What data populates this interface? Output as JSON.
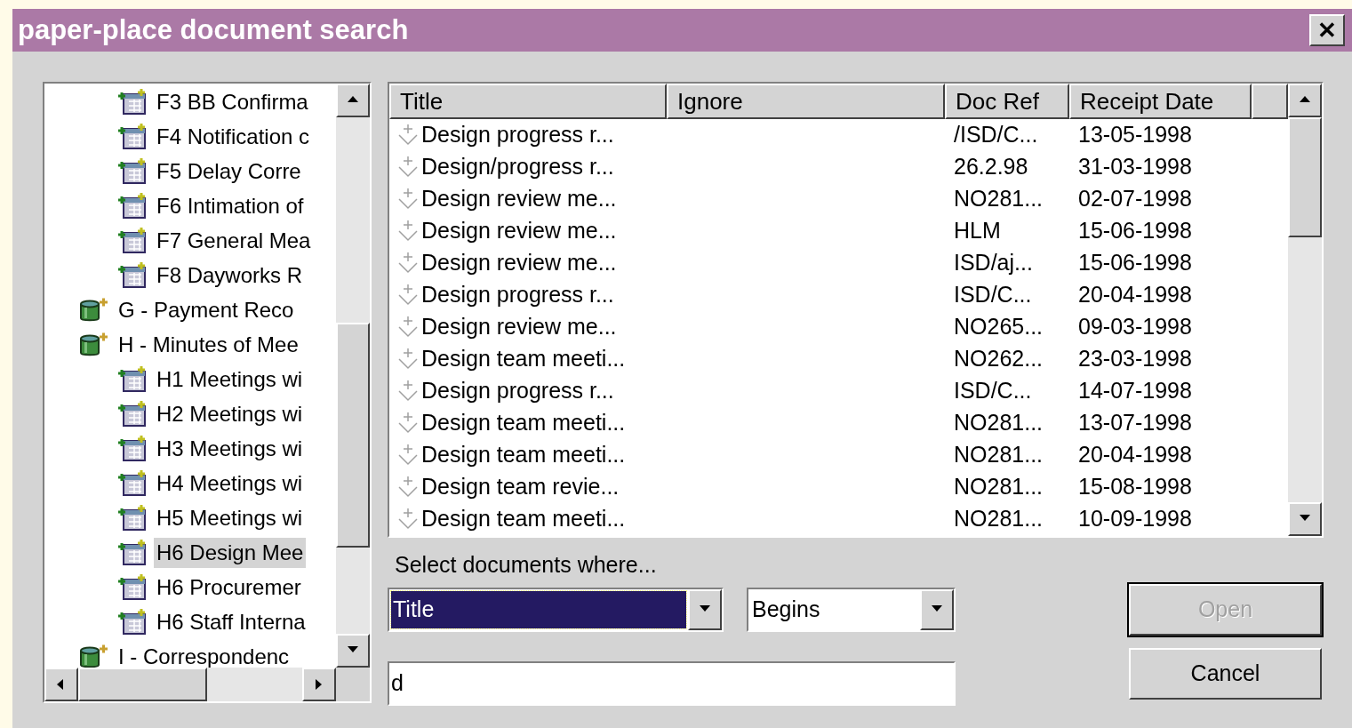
{
  "window": {
    "title": "paper-place document search",
    "close": "✕"
  },
  "tree": {
    "items": [
      {
        "children": [
          {
            "kind": "document",
            "label": "F3 BB Confirma",
            "selected": false
          },
          {
            "kind": "document",
            "label": "F4 Notification c",
            "selected": false
          },
          {
            "kind": "document",
            "label": "F5 Delay Corre",
            "selected": false
          },
          {
            "kind": "document",
            "label": "F6 Intimation of",
            "selected": false
          },
          {
            "kind": "document",
            "label": "F7 General Mea",
            "selected": false
          },
          {
            "kind": "document",
            "label": "F8 Dayworks R",
            "selected": false
          }
        ]
      },
      {
        "kind": "group",
        "label": "G - Payment Reco",
        "selected": false
      },
      {
        "kind": "group",
        "label": "H - Minutes of Mee",
        "selected": false,
        "children": [
          {
            "kind": "document",
            "label": "H1 Meetings wi",
            "selected": false
          },
          {
            "kind": "document",
            "label": "H2 Meetings wi",
            "selected": false
          },
          {
            "kind": "document",
            "label": "H3 Meetings wi",
            "selected": false
          },
          {
            "kind": "document",
            "label": "H4 Meetings wi",
            "selected": false
          },
          {
            "kind": "document",
            "label": "H5 Meetings wi",
            "selected": false
          },
          {
            "kind": "document",
            "label": "H6 Design Mee",
            "selected": true
          },
          {
            "kind": "document",
            "label": "H6 Procuremer",
            "selected": false
          },
          {
            "kind": "document",
            "label": "H6 Staff Interna",
            "selected": false
          }
        ]
      },
      {
        "kind": "group",
        "label": "I - Correspondenc",
        "selected": false
      }
    ]
  },
  "table": {
    "columns": [
      "Title",
      "Ignore",
      "Doc Ref",
      "Receipt Date"
    ],
    "rows": [
      [
        "Design progress r...",
        "",
        "/ISD/C...",
        "13-05-1998"
      ],
      [
        "Design/progress r...",
        "",
        "26.2.98",
        "31-03-1998"
      ],
      [
        "Design review me...",
        "",
        "NO281...",
        "02-07-1998"
      ],
      [
        "Design review me...",
        "",
        "HLM",
        "15-06-1998"
      ],
      [
        "Design review me...",
        "",
        "ISD/aj...",
        "15-06-1998"
      ],
      [
        "Design progress r...",
        "",
        "ISD/C...",
        "20-04-1998"
      ],
      [
        "Design review me...",
        "",
        "NO265...",
        "09-03-1998"
      ],
      [
        "Design team meeti...",
        "",
        "NO262...",
        "23-03-1998"
      ],
      [
        "Design progress r...",
        "",
        "ISD/C...",
        "14-07-1998"
      ],
      [
        "Design team meeti...",
        "",
        "NO281...",
        "13-07-1998"
      ],
      [
        "Design team meeti...",
        "",
        "NO281...",
        "20-04-1998"
      ],
      [
        "Design team revie...",
        "",
        "NO281...",
        "15-08-1998"
      ],
      [
        "Design team meeti...",
        "",
        "NO281...",
        "10-09-1998"
      ]
    ]
  },
  "criteria": {
    "label": "Select documents where...",
    "field": {
      "value": "Title",
      "focused": true
    },
    "operator": {
      "value": "Begins"
    },
    "search": {
      "value": "d"
    }
  },
  "buttons": [
    {
      "label": "Open",
      "disabled": true,
      "default": true
    },
    {
      "label": "Cancel",
      "disabled": false,
      "default": false
    }
  ]
}
